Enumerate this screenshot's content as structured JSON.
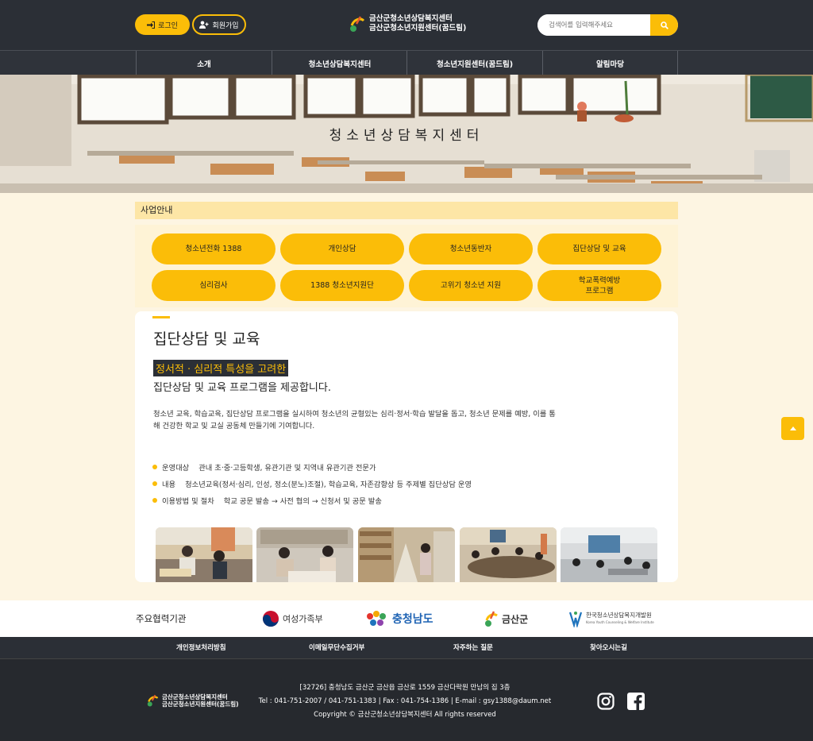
{
  "header": {
    "login_label": "로그인",
    "join_label": "회원가입",
    "logo_line1": "금산군청소년상담복지센터",
    "logo_line2": "금산군청소년지원센터(꿈드림)",
    "search_placeholder": "검색어를 입력해주세요"
  },
  "nav": {
    "items": [
      "소개",
      "청소년상담복지센터",
      "청소년지원센터(꿈드림)",
      "알림마당"
    ]
  },
  "hero": {
    "title": "청소년상담복지센터"
  },
  "section": {
    "title": "사업안내"
  },
  "tabs": [
    "청소년전화 1388",
    "개인상담",
    "청소년동반자",
    "집단상담 및 교육",
    "심리검사",
    "1388 청소년지원단",
    "고위기 청소년 지원",
    "학교폭력예방\n프로그램"
  ],
  "content": {
    "title": "집단상담 및 교육",
    "highlight": "정서적 · 심리적 특성을 고려한",
    "subtitle": "집단상담 및 교육 프로그램을 제공합니다.",
    "description": "청소년 교육, 학습교육, 집단상담 프로그램을 실시하여 청소년의 균형있는 심리·정서·학습 발달을 돕고, 청소년 문제를 예방, 이를 통해 건강한 학교 및 교실 공동체 만들기에 기여합니다.",
    "bullets": [
      {
        "label": "운영대상",
        "value": "관내 초·중·고등학생, 유관기관 및 지역내 유관기관 전문가"
      },
      {
        "label": "내용",
        "value": "청소년교육(정서·심리, 인성, 정소(분노)조절), 학습교육, 자존감향상 등 주제별 집단상담 운영"
      },
      {
        "label": "이용방법 및 절차",
        "value": "학교 공문 발송 → 사전 협의 → 신청서 및 공문 발송"
      }
    ]
  },
  "partners": {
    "label": "주요협력기관",
    "items": [
      "여성가족부",
      "충청남도",
      "금산군",
      "한국청소년상담복지개발원",
      "Korea Youth Counseling & Welfare Institute"
    ]
  },
  "footer": {
    "links": [
      "개인정보처리방침",
      "이메일무단수집거부",
      "자주하는 질문",
      "찾아오시는길"
    ],
    "logo_line1": "금산군청소년상담복지센터",
    "logo_line2": "금산군청소년지원센터(꿈드림)",
    "address": "[32726] 충청남도 금산군 금산읍 금산로 1559 금산다락원 만남의 집 3층",
    "contact": "Tel : 041-751-2007 / 041-751-1383 | Fax : 041-754-1386 | E-mail : gsy1388@daum.net",
    "copyright": "Copyright © 금산군청소년상담복지센터 All rights reserved"
  },
  "colors": {
    "accent": "#fbbd08",
    "dark": "#2b2f36",
    "cream": "#fdf5e2"
  }
}
